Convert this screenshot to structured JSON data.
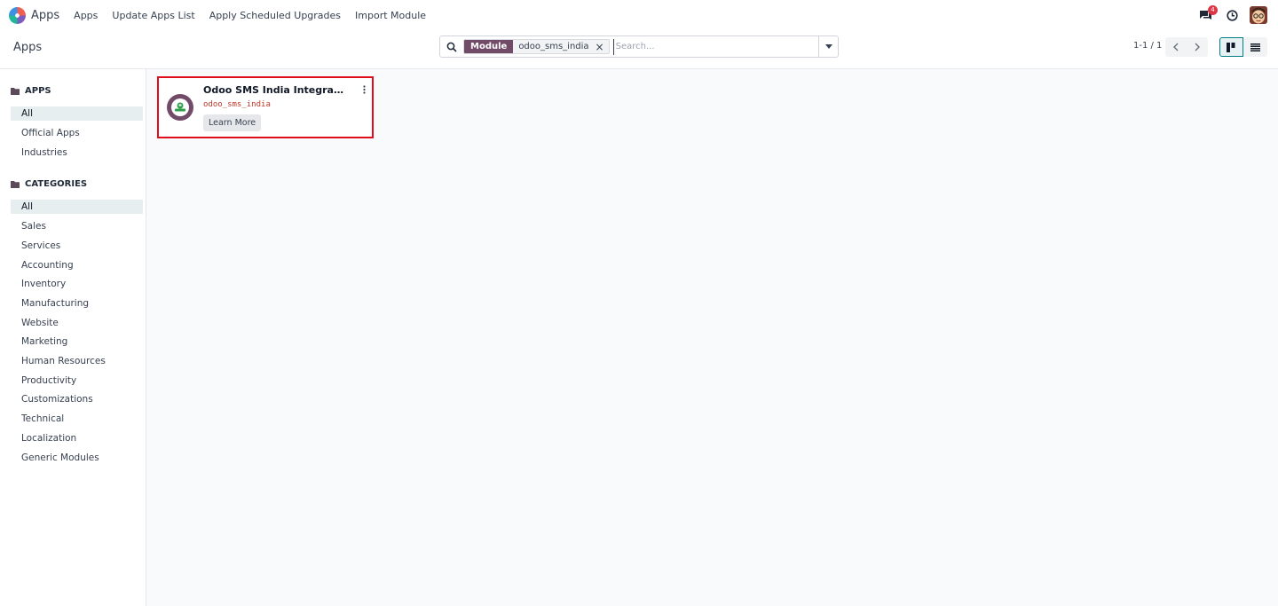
{
  "navbar": {
    "brand": "Apps",
    "menu": [
      "Apps",
      "Update Apps List",
      "Apply Scheduled Upgrades",
      "Import Module"
    ],
    "chat_badge": "4",
    "icons": {
      "chat": "chat-icon",
      "activity": "clock-icon",
      "user": "user-avatar"
    }
  },
  "control": {
    "breadcrumb": "Apps",
    "search": {
      "facet_label": "Module",
      "facet_value": "odoo_sms_india",
      "placeholder": "Search..."
    },
    "pager": "1-1 / 1"
  },
  "sidebar": {
    "apps_header": "APPS",
    "apps_items": [
      "All",
      "Official Apps",
      "Industries"
    ],
    "categories_header": "CATEGORIES",
    "categories_items": [
      "All",
      "Sales",
      "Services",
      "Accounting",
      "Inventory",
      "Manufacturing",
      "Website",
      "Marketing",
      "Human Resources",
      "Productivity",
      "Customizations",
      "Technical",
      "Localization",
      "Generic Modules"
    ]
  },
  "card": {
    "title": "Odoo SMS India Integration",
    "technical_name": "odoo_sms_india",
    "button": "Learn More"
  },
  "colors": {
    "brand": "#714b67",
    "accent": "#017e84",
    "highlight_border": "#e00d1b",
    "badge": "#dc3545"
  }
}
